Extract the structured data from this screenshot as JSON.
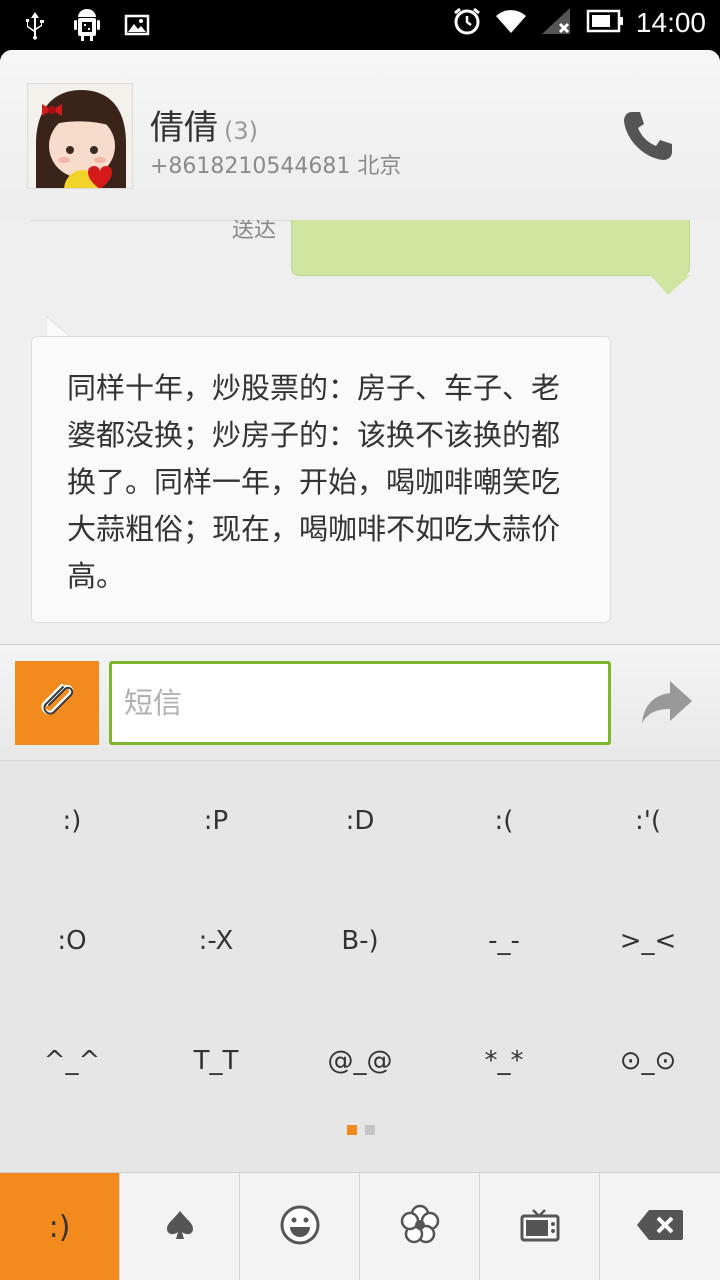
{
  "status_bar": {
    "time": "14:00",
    "icons": [
      "usb-icon",
      "android-debug-icon",
      "image-icon",
      "alarm-icon",
      "wifi-icon",
      "signal-icon",
      "battery-icon"
    ]
  },
  "contact": {
    "name": "倩倩",
    "count": "(3)",
    "phone_location": "+8618210544681 北京"
  },
  "conversation": {
    "sent_status": "送达",
    "received_message": "同样十年，炒股票的：房子、车子、老婆都没换；炒房子的：该换不该换的都换了。同样一年，开始，喝咖啡嘲笑吃大蒜粗俗；现在，喝咖啡不如吃大蒜价高。"
  },
  "compose": {
    "placeholder": "短信"
  },
  "emoticons": [
    ":)",
    ":P",
    ":D",
    ":(",
    ":'(",
    ":O",
    ":-X",
    "B-)",
    "-_-",
    ">_<",
    "^_^",
    "T_T",
    "@_@",
    "*_*",
    "⊙_⊙"
  ],
  "pager": {
    "pages": 2,
    "current": 1
  },
  "tabs": [
    {
      "label": ":)",
      "icon": "emoticon-text-icon",
      "active": true
    },
    {
      "icon": "spade-icon"
    },
    {
      "icon": "smiley-face-icon"
    },
    {
      "icon": "flower-icon"
    },
    {
      "icon": "tv-icon"
    },
    {
      "icon": "backspace-icon"
    }
  ],
  "colors": {
    "accent": "#f28a1e",
    "input_border": "#7db52b",
    "sent_bubble": "#cfe5a0"
  }
}
